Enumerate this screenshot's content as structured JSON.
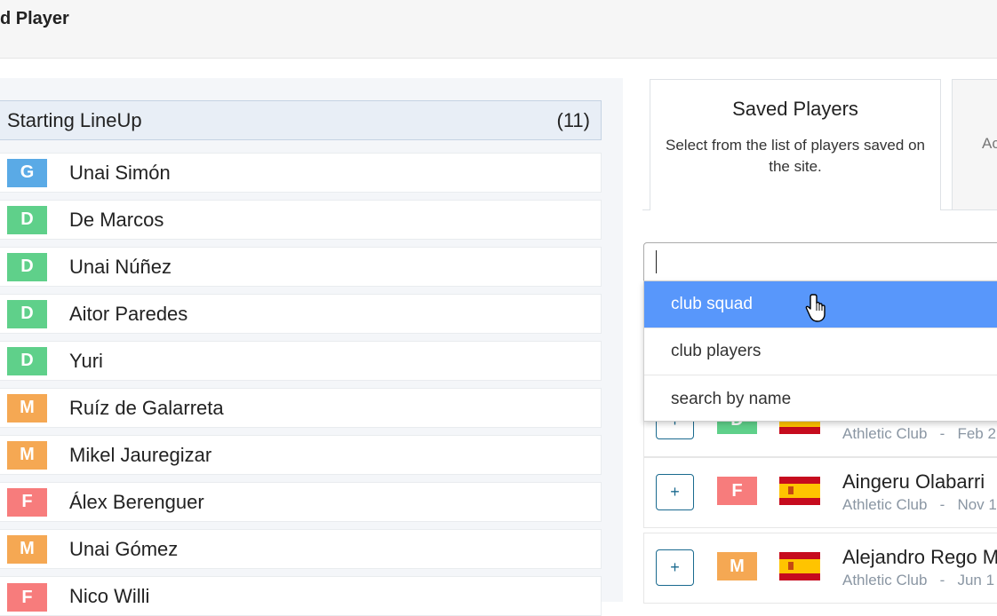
{
  "header": {
    "title": "d Player"
  },
  "lineup": {
    "title": "Starting LineUp",
    "count": "(11)",
    "players": [
      {
        "pos": "G",
        "name": "Unai Simón"
      },
      {
        "pos": "D",
        "name": "De Marcos"
      },
      {
        "pos": "D",
        "name": "Unai Núñez"
      },
      {
        "pos": "D",
        "name": "Aitor Paredes"
      },
      {
        "pos": "D",
        "name": "Yuri"
      },
      {
        "pos": "M",
        "name": "Ruíz de Galarreta"
      },
      {
        "pos": "M",
        "name": "Mikel Jauregizar"
      },
      {
        "pos": "F",
        "name": "Álex Berenguer"
      },
      {
        "pos": "M",
        "name": "Unai Gómez"
      },
      {
        "pos": "F",
        "name": "Nico Willi"
      }
    ]
  },
  "tabs": {
    "saved": {
      "title": "Saved Players",
      "desc": "Select from the list of players saved on the site."
    },
    "other": {
      "desc": "Ac"
    }
  },
  "search": {
    "value": ""
  },
  "dropdown": {
    "options": [
      "club squad",
      "club players",
      "search by name"
    ],
    "highlighted": "club squad"
  },
  "results": [
    {
      "pos": "D",
      "name": "",
      "club": "Athletic Club",
      "sep": "-",
      "date": "Feb 2"
    },
    {
      "pos": "F",
      "name": "Aingeru Olabarri",
      "club": "Athletic Club",
      "sep": "-",
      "date": "Nov 1"
    },
    {
      "pos": "M",
      "name": "Alejandro Rego M",
      "club": "Athletic Club",
      "sep": "-",
      "date": "Jun 1"
    }
  ],
  "colors": {
    "G": "#5aaae6",
    "D": "#5fd08a",
    "M": "#f5a853",
    "F": "#f77c7c",
    "highlight": "#5897fb"
  }
}
